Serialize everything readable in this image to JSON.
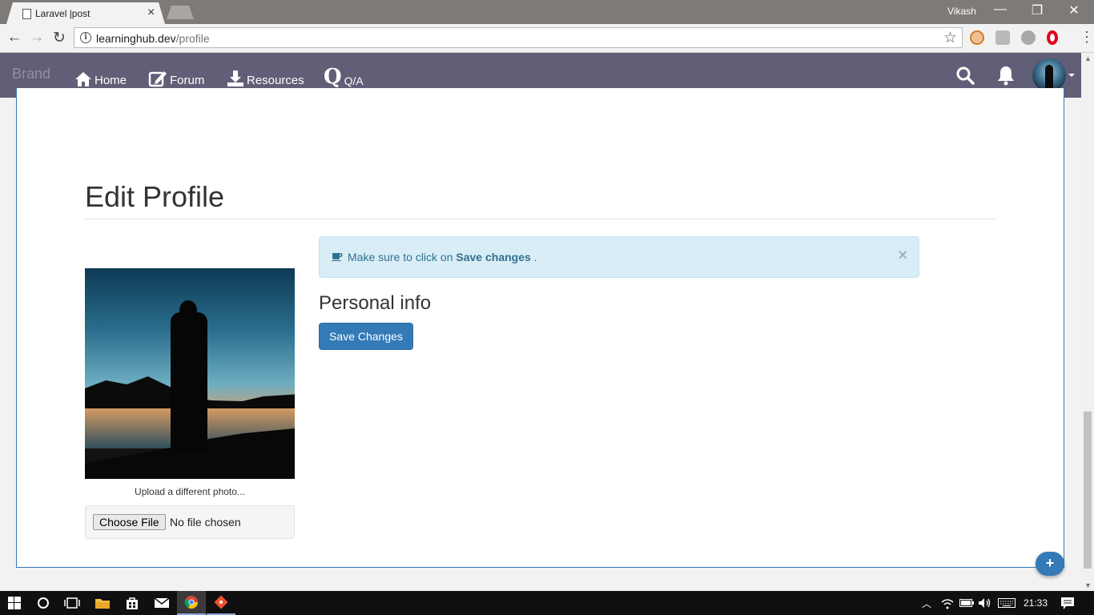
{
  "browser": {
    "tab_title": "Laravel |post",
    "tab_close": "×",
    "user_name": "Vikash",
    "url_host": "learninghub.dev",
    "url_path": "/profile",
    "minimize": "—",
    "restore": "❐",
    "close": "✕",
    "back": "←",
    "forward": "→",
    "reload": "↻",
    "star": "☆",
    "menu": "⋮"
  },
  "navbar": {
    "brand": "Brand",
    "items": [
      {
        "label": "Home",
        "icon": "home-icon"
      },
      {
        "label": "Forum",
        "icon": "edit-icon"
      },
      {
        "label": "Resources",
        "icon": "download-icon"
      },
      {
        "label": "Q/A",
        "icon": "q-icon",
        "icon_text": "Q"
      }
    ],
    "right_icons": [
      "search-icon",
      "bell-icon",
      "avatar"
    ]
  },
  "main": {
    "title": "Edit Profile",
    "photo_caption": "Upload a different photo...",
    "file_button": "Choose File",
    "file_status": "No file chosen",
    "alert": {
      "prefix": "Make sure to click on",
      "emphasis": "Save changes",
      "suffix": ".",
      "close": "×"
    },
    "section_title": "Personal info",
    "save_button": "Save Changes",
    "fab_label": "+"
  },
  "taskbar": {
    "time": "21:33"
  },
  "colors": {
    "navbar": "#605f77",
    "primary": "#337ab7",
    "alert_bg": "#d9edf7",
    "alert_text": "#31708f"
  }
}
